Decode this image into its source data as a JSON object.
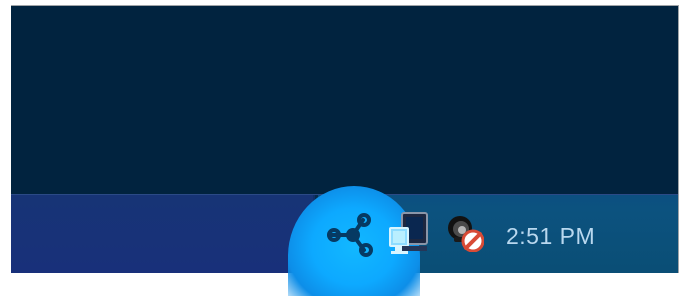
{
  "taskbar": {
    "tray": {
      "icons": [
        {
          "name": "share-network-icon"
        },
        {
          "name": "computer-network-icon"
        },
        {
          "name": "blocked-webcam-icon"
        }
      ],
      "clock": "2:51 PM"
    }
  },
  "colors": {
    "desktop": "#01233f",
    "taskbar": "#173476",
    "tray": "#0c527f",
    "highlight": "#12b8ff",
    "clock_text": "#b9d8ef"
  }
}
